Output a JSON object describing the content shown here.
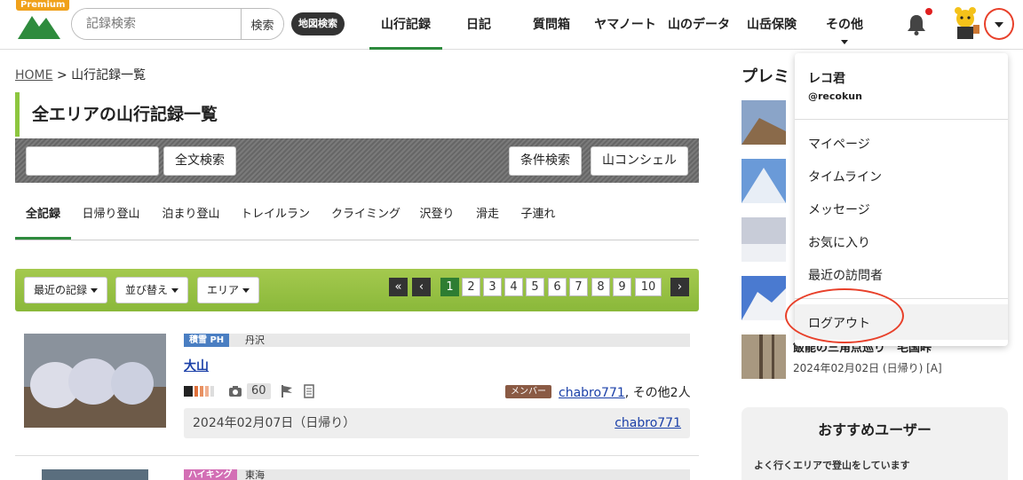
{
  "header": {
    "premium_label": "Premium",
    "search_placeholder": "記録検索",
    "search_button": "検索",
    "map_search": "地図検索",
    "nav": [
      {
        "label": "山行記録"
      },
      {
        "label": "日記"
      },
      {
        "label": "質問箱"
      },
      {
        "label": "ヤマノート"
      },
      {
        "label": "山のデータ"
      },
      {
        "label": "山岳保険"
      },
      {
        "label": "その他"
      }
    ],
    "colors": {
      "brand_green": "#2e8b3d",
      "notification_dot": "#e02020",
      "annotation_red": "#e8402a"
    }
  },
  "breadcrumb": {
    "home": "HOME",
    "separator": ">",
    "current": "山行記録一覧"
  },
  "page_title": "全エリアの山行記録一覧",
  "search_bar": {
    "fulltext_button": "全文検索",
    "condition_button": "条件検索",
    "concierge_button": "山コンシェル"
  },
  "tabs": [
    {
      "label": "全記録"
    },
    {
      "label": "日帰り登山"
    },
    {
      "label": "泊まり登山"
    },
    {
      "label": "トレイルラン"
    },
    {
      "label": "クライミング"
    },
    {
      "label": "沢登り"
    },
    {
      "label": "滑走"
    },
    {
      "label": "子連れ"
    }
  ],
  "toolbar": {
    "recent": "最近の記録",
    "sort": "並び替え",
    "area": "エリア",
    "first": "«",
    "prev": "‹",
    "next": "›",
    "pages": [
      "1",
      "2",
      "3",
      "4",
      "5",
      "6",
      "7",
      "8",
      "9",
      "10"
    ]
  },
  "record": {
    "category": "積雪 PH",
    "area": "丹沢",
    "title": "大山",
    "photo_count": "60",
    "member_badge": "メンバー",
    "member": "chabro771",
    "others": ", その他2人",
    "date": "2024年02月07日（日帰り）",
    "author": "chabro771"
  },
  "record2": {
    "category": "ハイキング",
    "area": "東海"
  },
  "sidebar": {
    "title": "プレミ",
    "rec_title": "飯能の三角点巡り　毛国峠",
    "rec_date": "2024年02月02日 (日帰り) [A]",
    "recommended_title": "おすすめユーザー",
    "recommended_sub": "よく行くエリアで登山をしています"
  },
  "user_menu": {
    "name": "レコ君",
    "handle": "@recokun",
    "items": [
      {
        "label": "マイページ"
      },
      {
        "label": "タイムライン"
      },
      {
        "label": "メッセージ"
      },
      {
        "label": "お気に入り"
      },
      {
        "label": "最近の訪問者"
      }
    ],
    "logout": "ログアウト"
  }
}
